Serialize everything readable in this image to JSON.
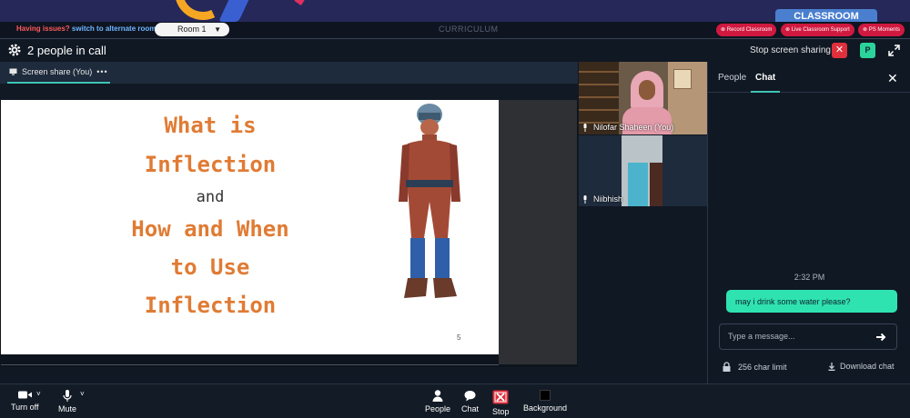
{
  "top": {
    "classroom_tab": "CLASSROOM",
    "issues_text": "Having issues?",
    "alternate_link": "switch to alternate room",
    "room_selected": "Room 1",
    "curriculum": "CURRICULUM",
    "pills": [
      "Record Classroom",
      "Live Classroom Support",
      "PS Moments"
    ]
  },
  "call": {
    "people_count": "2 people in call",
    "stop_sharing_label": "Stop screen sharing",
    "avatar_initial": "P"
  },
  "share": {
    "tab_label": "Screen share (You)",
    "tab_more": "•••"
  },
  "slide": {
    "line1": "What is",
    "line2": "Inflection",
    "line3": "and",
    "line4": "How and When",
    "line5": "to Use",
    "line6": "Inflection",
    "page_number": "5"
  },
  "participants": [
    {
      "name": "Nilofar Shaheen (You)"
    },
    {
      "name": "Niibhish"
    }
  ],
  "chat": {
    "tab_people": "People",
    "tab_chat": "Chat",
    "time": "2:32 PM",
    "message": "may i drink some water please?",
    "input_placeholder": "Type a message...",
    "char_limit": "256 char limit",
    "download": "Download chat"
  },
  "controls": {
    "turn_off": "Turn off",
    "mute": "Mute",
    "people": "People",
    "chat": "Chat",
    "stop": "Stop",
    "background": "Background"
  },
  "colors": {
    "accent_teal": "#3fc3b5",
    "chat_bubble": "#2fe3b0",
    "danger": "#e0303c",
    "slide_title": "#e07b34"
  }
}
